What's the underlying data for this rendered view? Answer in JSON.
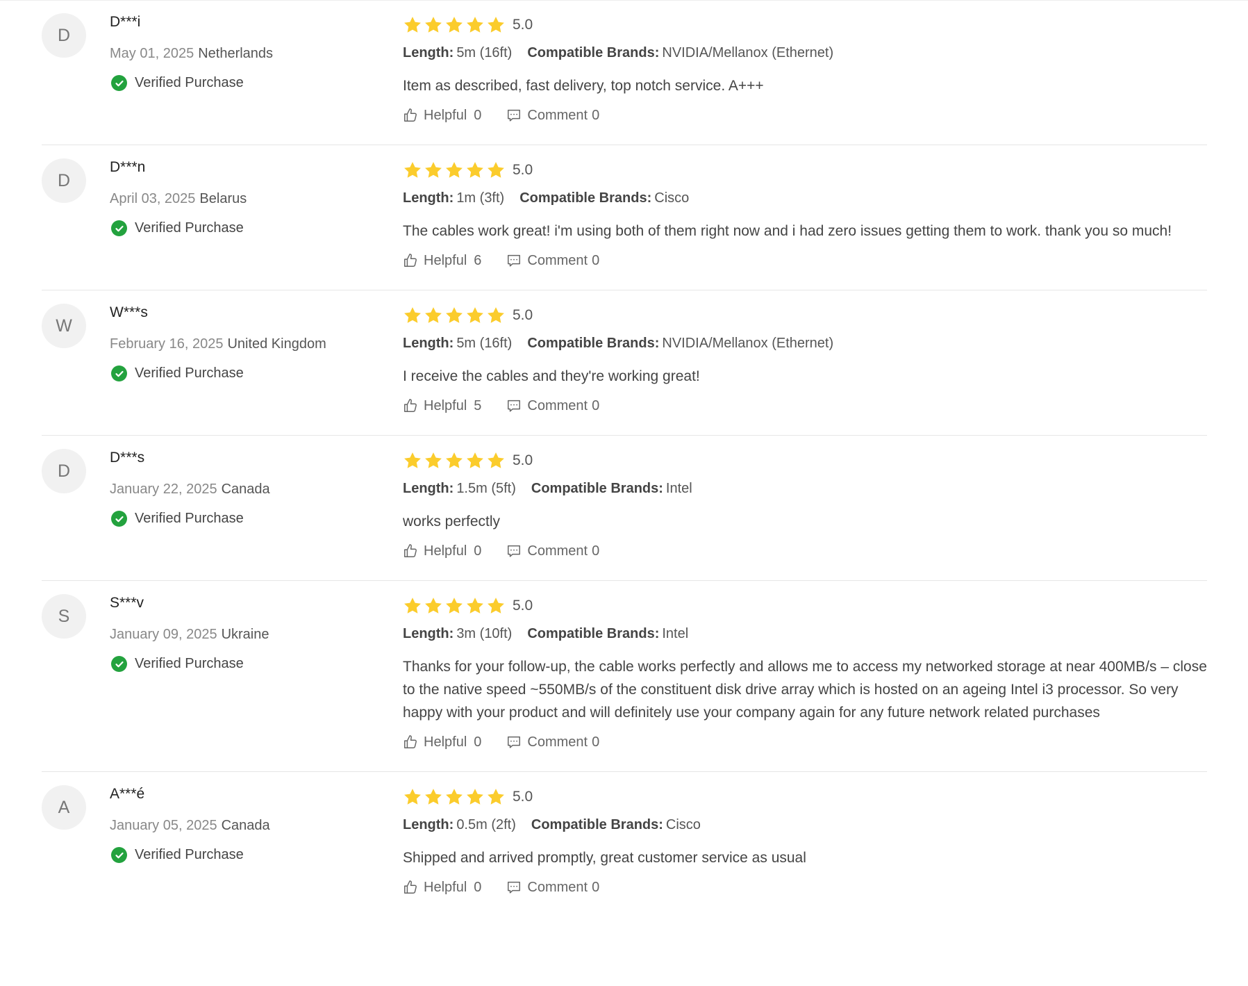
{
  "colors": {
    "star": "#fbcc2c",
    "verified": "#23a23e",
    "divider": "#e6e6e6",
    "avatar_bg": "#f1f1f1"
  },
  "icons": {
    "star": "star-icon",
    "verified": "check-circle-icon",
    "helpful": "thumbs-up-icon",
    "comment": "comment-icon"
  },
  "labels": {
    "verified": "Verified Purchase",
    "helpful": "Helpful",
    "comment": "Comment",
    "length_key": "Length:",
    "brands_key": "Compatible Brands:"
  },
  "reviews": [
    {
      "initial": "D",
      "name": "D***i",
      "date": "May 01, 2025",
      "country": "Netherlands",
      "rating": 5,
      "score": "5.0",
      "length": "5m (16ft)",
      "brands": "NVIDIA/Mellanox (Ethernet)",
      "text": "Item as described, fast delivery, top notch service. A+++",
      "helpful": "0",
      "comments": "0"
    },
    {
      "initial": "D",
      "name": "D***n",
      "date": "April 03, 2025",
      "country": "Belarus",
      "rating": 5,
      "score": "5.0",
      "length": "1m (3ft)",
      "brands": "Cisco",
      "text": "The cables work great! i'm using both of them right now and i had zero issues getting them to work. thank you so much!",
      "helpful": "6",
      "comments": "0"
    },
    {
      "initial": "W",
      "name": "W***s",
      "date": "February 16, 2025",
      "country": "United Kingdom",
      "rating": 5,
      "score": "5.0",
      "length": "5m (16ft)",
      "brands": "NVIDIA/Mellanox (Ethernet)",
      "text": "I receive the cables and they're working great!",
      "helpful": "5",
      "comments": "0"
    },
    {
      "initial": "D",
      "name": "D***s",
      "date": "January 22, 2025",
      "country": "Canada",
      "rating": 5,
      "score": "5.0",
      "length": "1.5m (5ft)",
      "brands": "Intel",
      "text": "works perfectly",
      "helpful": "0",
      "comments": "0"
    },
    {
      "initial": "S",
      "name": "S***v",
      "date": "January 09, 2025",
      "country": "Ukraine",
      "rating": 5,
      "score": "5.0",
      "length": "3m (10ft)",
      "brands": "Intel",
      "text": "Thanks for your follow-up, the cable works perfectly and allows me to access my networked storage at near 400MB/s – close to the native speed ~550MB/s of the constituent disk drive array which is hosted on an ageing Intel i3 processor. So very happy with your product and will definitely use your company again for any future network related purchases",
      "helpful": "0",
      "comments": "0"
    },
    {
      "initial": "A",
      "name": "A***é",
      "date": "January 05, 2025",
      "country": "Canada",
      "rating": 5,
      "score": "5.0",
      "length": "0.5m (2ft)",
      "brands": "Cisco",
      "text": "Shipped and arrived promptly, great customer service as usual",
      "helpful": "0",
      "comments": "0"
    }
  ]
}
